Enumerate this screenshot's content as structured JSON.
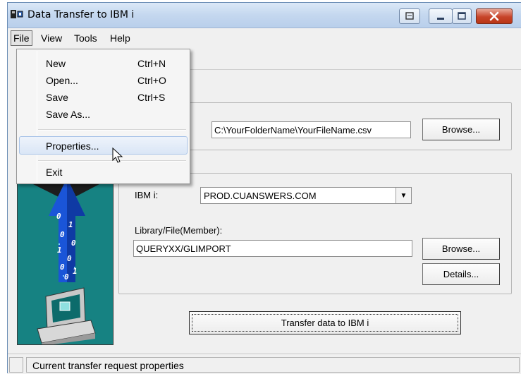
{
  "window": {
    "title": "Data Transfer to IBM i"
  },
  "menubar": {
    "file": "File",
    "view": "View",
    "tools": "Tools",
    "help": "Help"
  },
  "file_menu": {
    "new": {
      "label": "New",
      "shortcut": "Ctrl+N"
    },
    "open": {
      "label": "Open...",
      "shortcut": "Ctrl+O"
    },
    "save": {
      "label": "Save",
      "shortcut": "Ctrl+S"
    },
    "save_as": {
      "label": "Save As..."
    },
    "properties": {
      "label": "Properties..."
    },
    "exit": {
      "label": "Exit"
    }
  },
  "pc_section": {
    "file_suffix": ":",
    "file_path": "C:\\YourFolderName\\YourFileName.csv",
    "browse_label": "Browse..."
  },
  "ibm_section": {
    "system_label": "IBM i:",
    "system_value": "PROD.CUANSWERS.COM",
    "library_label": "Library/File(Member):",
    "library_value": "QUERYXX/GLIMPORT",
    "browse_label": "Browse...",
    "details_label": "Details..."
  },
  "transfer_button": "Transfer data to IBM i",
  "status": {
    "text": "Current transfer request properties"
  },
  "colors": {
    "picture_bg": "#168282",
    "arrow_blue": "#1a55d8",
    "highlight": "#dae6f6"
  }
}
